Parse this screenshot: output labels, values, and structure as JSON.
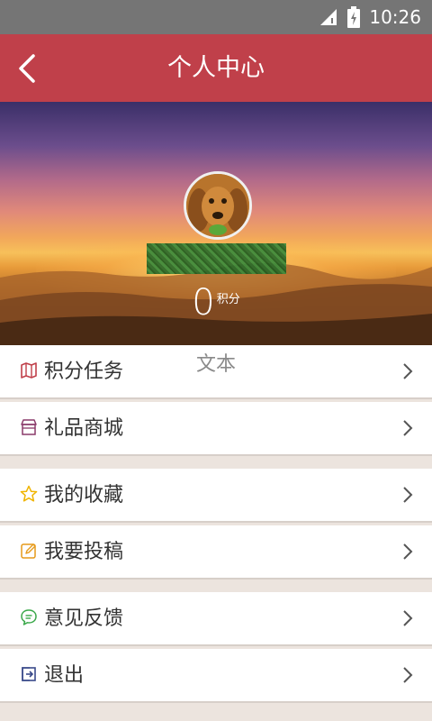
{
  "status_bar": {
    "time": "10:26"
  },
  "header": {
    "title": "个人中心"
  },
  "profile": {
    "points_value": "0",
    "points_unit": "积分",
    "text_label": "文本"
  },
  "menu": {
    "group1": [
      {
        "label": "积分任务",
        "icon": "map-icon",
        "color": "#c0404a"
      },
      {
        "label": "礼品商城",
        "icon": "store-icon",
        "color": "#8a3a6a"
      }
    ],
    "group2": [
      {
        "label": "我的收藏",
        "icon": "star-icon",
        "color": "#f0b400"
      },
      {
        "label": "我要投稿",
        "icon": "edit-icon",
        "color": "#e69a1a"
      }
    ],
    "group3": [
      {
        "label": "意见反馈",
        "icon": "chat-icon",
        "color": "#3aa84a"
      },
      {
        "label": "退出",
        "icon": "exit-icon",
        "color": "#3a4a8a"
      }
    ]
  },
  "colors": {
    "app_bar": "#c0404a",
    "status_bar": "#757575",
    "background": "#ece4de"
  }
}
